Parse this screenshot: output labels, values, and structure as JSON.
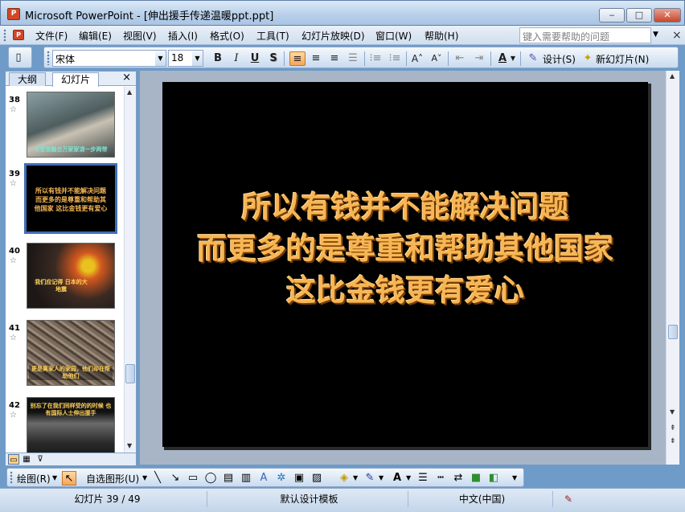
{
  "window": {
    "app_icon": "powerpoint-icon",
    "title": "Microsoft PowerPoint - [伸出援手传递温暖ppt.ppt]",
    "minimize": "‒",
    "maximize": "□",
    "close": "✕"
  },
  "menu": {
    "items": [
      "文件(F)",
      "编辑(E)",
      "视图(V)",
      "插入(I)",
      "格式(O)",
      "工具(T)",
      "幻灯片放映(D)",
      "窗口(W)",
      "帮助(H)"
    ],
    "help_placeholder": "键入需要帮助的问题"
  },
  "toolbar": {
    "font_name": "宋体",
    "font_size": "18",
    "bold": "B",
    "italic": "I",
    "underline": "U",
    "shadow": "S",
    "design_label": "设计(S)",
    "new_slide_label": "新幻灯片(N)"
  },
  "left_pane": {
    "tabs": [
      "大纲",
      "幻灯片"
    ],
    "close": "×",
    "thumbnails": [
      {
        "number": "38",
        "caption": "将爱里融合万家家请一步两带",
        "bg": "#5b6f72"
      },
      {
        "number": "39",
        "caption": "所以有钱并不能解决问题 而更多的是尊重和帮助其他国家 这比金钱更有爱心",
        "bg": "#000000",
        "selected": true
      },
      {
        "number": "40",
        "caption": "我们应记得 日本的大地震",
        "bg": "#3b2a22"
      },
      {
        "number": "41",
        "caption": "更是离家人的家园，他们却在帮助他们",
        "bg": "#6a5a4f"
      },
      {
        "number": "42",
        "caption": "别忘了在我们同样受的的时候 也有国际人士伸出援手",
        "bg": "#2c2c2c"
      }
    ]
  },
  "slide": {
    "lines": [
      "所以有钱并不能解决问题",
      "而更多的是尊重和帮助其他国家",
      "这比金钱更有爱心"
    ]
  },
  "drawbar": {
    "draw_label": "绘图(R)",
    "autoshapes_label": "自选图形(U)"
  },
  "status": {
    "slide_position": "幻灯片 39 / 49",
    "design_template": "默认设计模板",
    "language": "中文(中国)"
  }
}
